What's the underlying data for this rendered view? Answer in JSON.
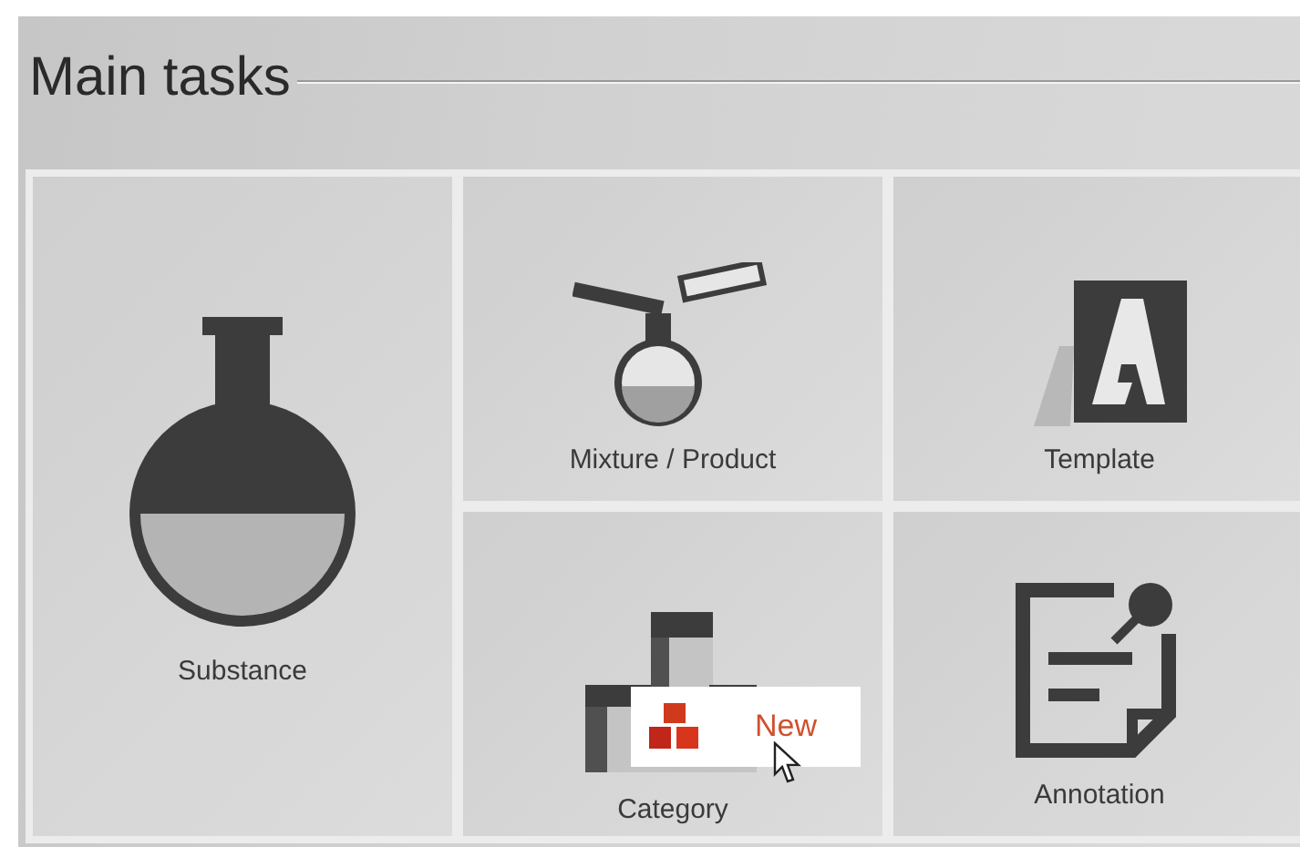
{
  "header": {
    "title": "Main tasks"
  },
  "tiles": [
    {
      "kind": "substance",
      "label": "Substance"
    },
    {
      "kind": "mixture",
      "label": "Mixture / Product"
    },
    {
      "kind": "template",
      "label": "Template"
    },
    {
      "kind": "category",
      "label": "Category"
    },
    {
      "kind": "annotation",
      "label": "Annotation"
    }
  ],
  "popup": {
    "label": "New"
  }
}
